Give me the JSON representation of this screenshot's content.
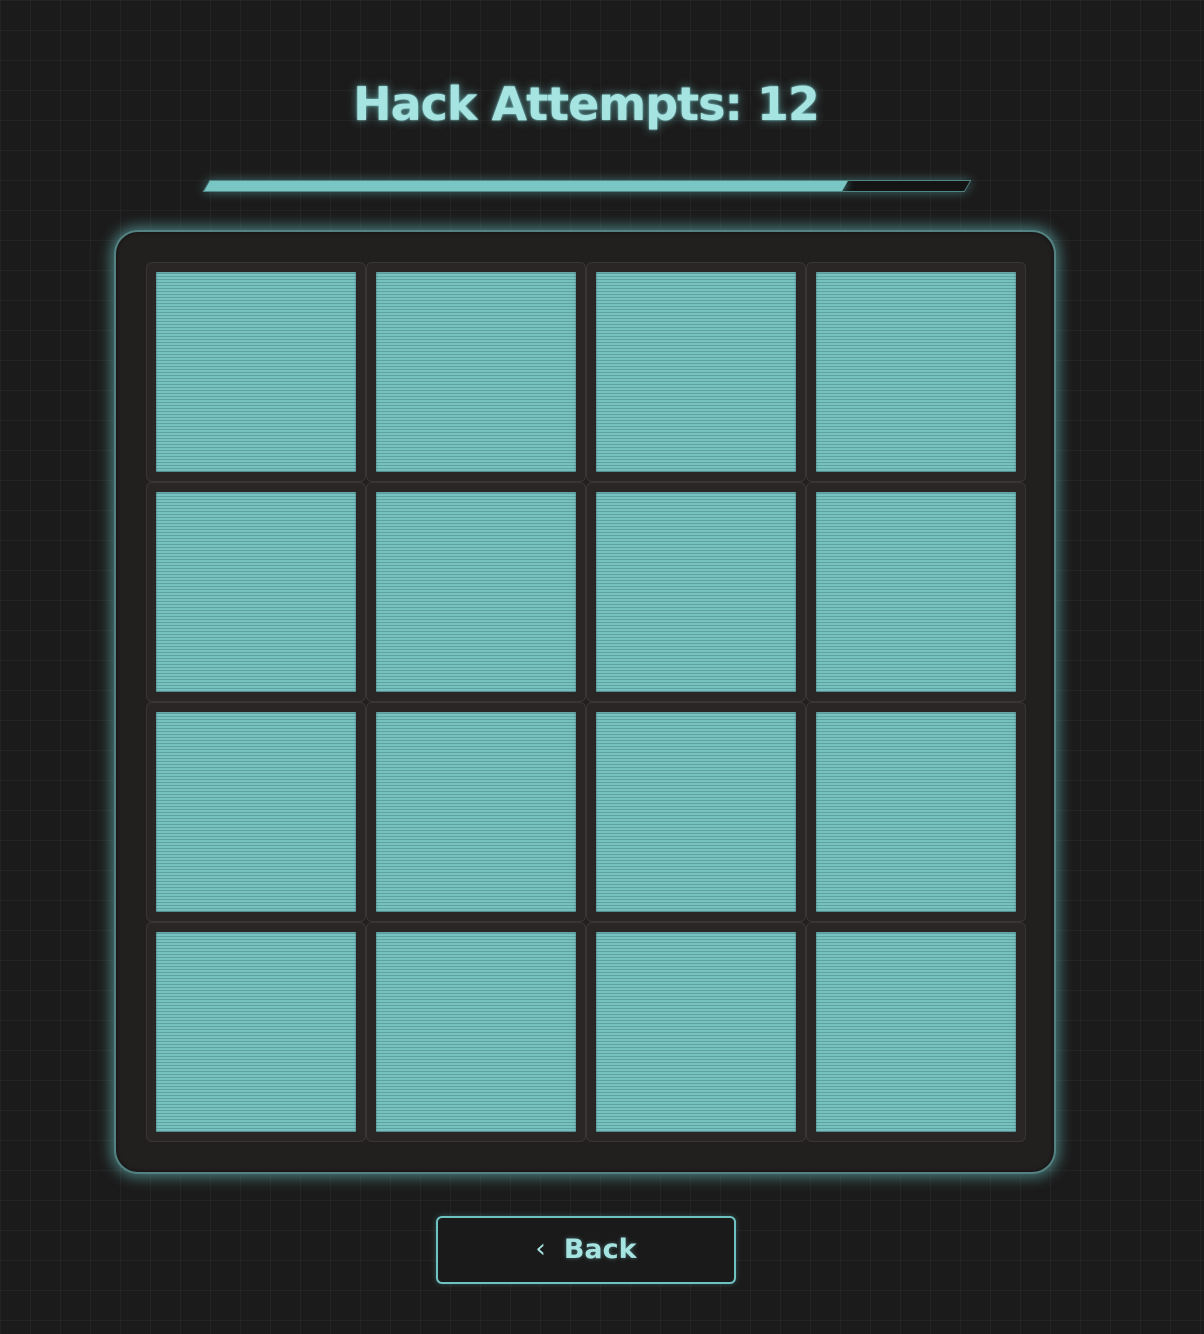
{
  "header": {
    "title": "Hack Attempts: 12"
  },
  "progress": {
    "fraction": 0.84
  },
  "board": {
    "rows": 4,
    "columns": 4,
    "tile_color": "#76c2c1",
    "accent_color": "#a6e4e2"
  },
  "footer": {
    "back_icon": "‹",
    "back_icon_name": "chevron-left-icon",
    "back_label": "Back"
  }
}
